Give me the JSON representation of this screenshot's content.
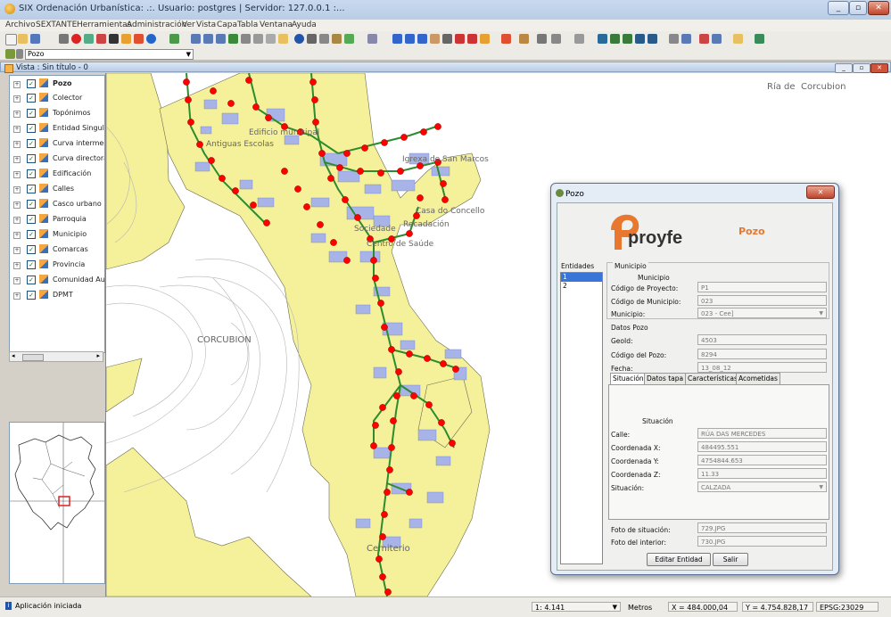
{
  "window": {
    "title": "SIX Ordenación Urbanística: .:. Usuario: postgres | Servidor: 127.0.0.1 :..."
  },
  "menu": [
    "Archivo",
    "SEXTANTE",
    "Herramientas",
    "Administración",
    "Ver",
    "Vista",
    "Capa",
    "Tabla",
    "Ventana",
    "Ayuda"
  ],
  "toolbar2": {
    "selected_layer": "Pozo"
  },
  "view": {
    "title": "Vista : Sin título - 0"
  },
  "layers": [
    {
      "label": "Pozo",
      "bold": true
    },
    {
      "label": "Colector"
    },
    {
      "label": "Topónimos"
    },
    {
      "label": "Entidad Singular"
    },
    {
      "label": "Curva intermedia"
    },
    {
      "label": "Curva directora"
    },
    {
      "label": "Edificación"
    },
    {
      "label": "Calles"
    },
    {
      "label": "Casco urbano"
    },
    {
      "label": "Parroquia"
    },
    {
      "label": "Municipio"
    },
    {
      "label": "Comarcas"
    },
    {
      "label": "Provincia"
    },
    {
      "label": "Comunidad Autónoma"
    },
    {
      "label": "DPMT"
    }
  ],
  "map": {
    "label_ria": "Ría de",
    "label_corcubion_top": "Corcubion",
    "label_corcubion": "CORCUBION",
    "label_cemiterio": "Cemiterio",
    "label_igrexa": "Igrexa de San Marcos",
    "label_casa": "Casa do Concello",
    "label_recadacion": "Recadación",
    "label_sociedade": "Sociedade",
    "label_centro": "Centro de Saúde",
    "label_antiguas": "Antiguas Escolas",
    "label_edificio": "Edificio municipal"
  },
  "dialog": {
    "title": "Pozo",
    "logo_text": "proyfe",
    "heading": "Pozo",
    "entidades_label": "Entidades",
    "entidades": [
      "1",
      "2"
    ],
    "group_municipio": "Municipio",
    "sub_municipio": "Municipio",
    "codigo_proyecto_label": "Código de Proyecto:",
    "codigo_proyecto": "P1",
    "codigo_municipio_label": "Código de Municipio:",
    "codigo_municipio": "023",
    "municipio_label": "Municipio:",
    "municipio": "023 - Cee]",
    "datos_pozo": "Datos Pozo",
    "geoid_label": "GeoId:",
    "geoid": "4503",
    "codigo_pozo_label": "Código del Pozo:",
    "codigo_pozo": "8294",
    "fecha_label": "Fecha:",
    "fecha": "13_08_12",
    "tabs": [
      "Situación",
      "Datos tapa",
      "Características",
      "Acometidas"
    ],
    "situacion_heading": "Situación",
    "calle_label": "Calle:",
    "calle": "RÚA DAS MERCEDES",
    "coord_x_label": "Coordenada X:",
    "coord_x": "484495.551",
    "coord_y_label": "Coordenada Y:",
    "coord_y": "4754844.653",
    "coord_z_label": "Coordenada Z:",
    "coord_z": "11.33",
    "situacion_label": "Situación:",
    "situacion": "CALZADA",
    "foto_situacion_label": "Foto de situación:",
    "foto_situacion": "729.JPG",
    "foto_interior_label": "Foto del interior:",
    "foto_interior": "730.JPG",
    "btn_editar": "Editar Entidad",
    "btn_salir": "Salir"
  },
  "status": {
    "message": "Aplicación iniciada",
    "scale": "1: 4.141",
    "units": "Metros",
    "x": "X = 484.000,04",
    "y": "Y = 4.754.828,17",
    "epsg": "EPSG:23029"
  },
  "colors": {
    "land": "#f4f19a",
    "road_net": "#2e8b2e",
    "manhole": "#ff0000",
    "building": "#a8b4e8",
    "accent": "#e87830"
  }
}
